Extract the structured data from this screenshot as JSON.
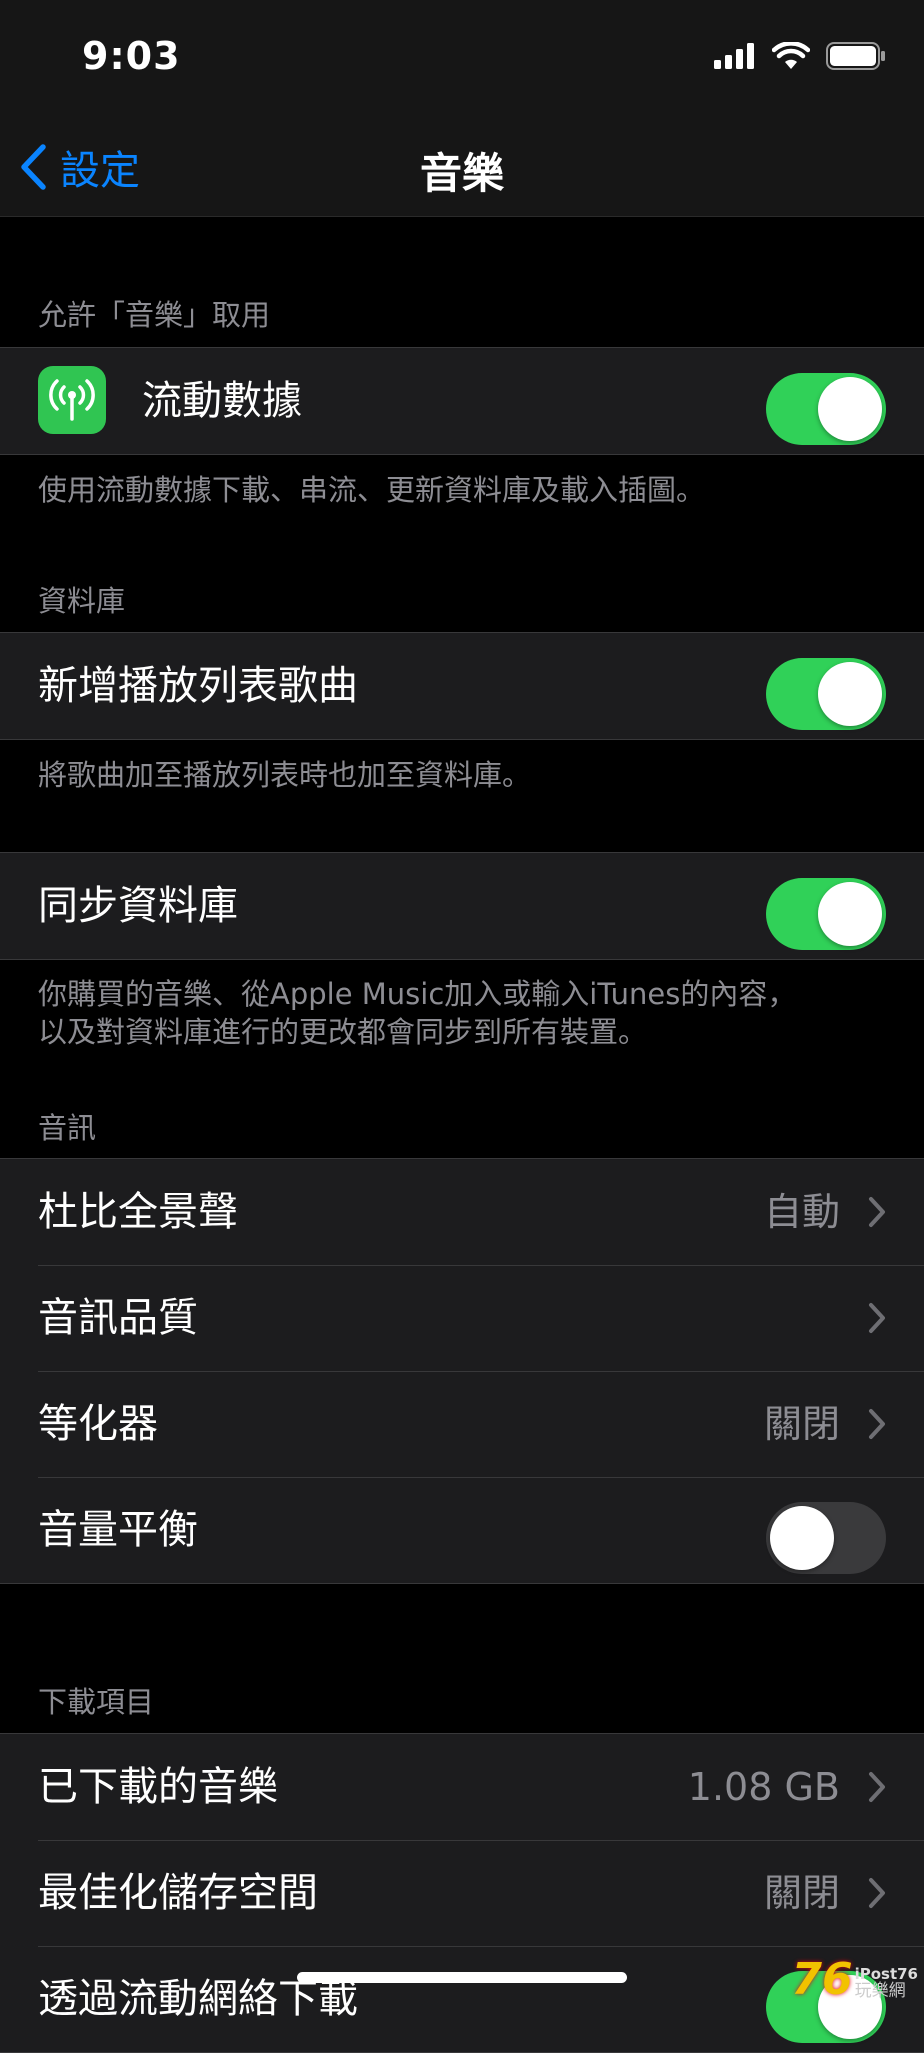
{
  "status_bar": {
    "time": "9:03"
  },
  "nav": {
    "back_label": "設定",
    "title": "音樂"
  },
  "sections": {
    "access": {
      "header": "允許「音樂」取用",
      "cellular": {
        "label": "流動數據",
        "on": true
      },
      "footer": "使用流動數據下載、串流、更新資料庫及載入插圖。"
    },
    "library": {
      "header": "資料庫",
      "add_playlist_songs": {
        "label": "新增播放列表歌曲",
        "on": true
      },
      "footer": "將歌曲加至播放列表時也加至資料庫。"
    },
    "sync": {
      "sync_library": {
        "label": "同步資料庫",
        "on": true
      },
      "footer_line1": "你購買的音樂、從Apple Music加入或輸入iTunes的內容，",
      "footer_line2": "以及對資料庫進行的更改都會同步到所有裝置。"
    },
    "audio": {
      "header": "音訊",
      "dolby": {
        "label": "杜比全景聲",
        "value": "自動"
      },
      "quality": {
        "label": "音訊品質"
      },
      "eq": {
        "label": "等化器",
        "value": "關閉"
      },
      "sound_check": {
        "label": "音量平衡",
        "on": false
      }
    },
    "downloads": {
      "header": "下載項目",
      "downloaded": {
        "label": "已下載的音樂",
        "value": "1.08 GB"
      },
      "optimize": {
        "label": "最佳化儲存空間",
        "value": "關閉"
      },
      "cellular_download": {
        "label": "透過流動網絡下載",
        "on": true
      }
    }
  },
  "watermark": {
    "number": "76",
    "brand": "iPost76",
    "site": "玩樂網"
  },
  "colors": {
    "accent": "#0a84ff",
    "toggle_on": "#30d158",
    "cellular_icon_bg": "#30c552"
  }
}
